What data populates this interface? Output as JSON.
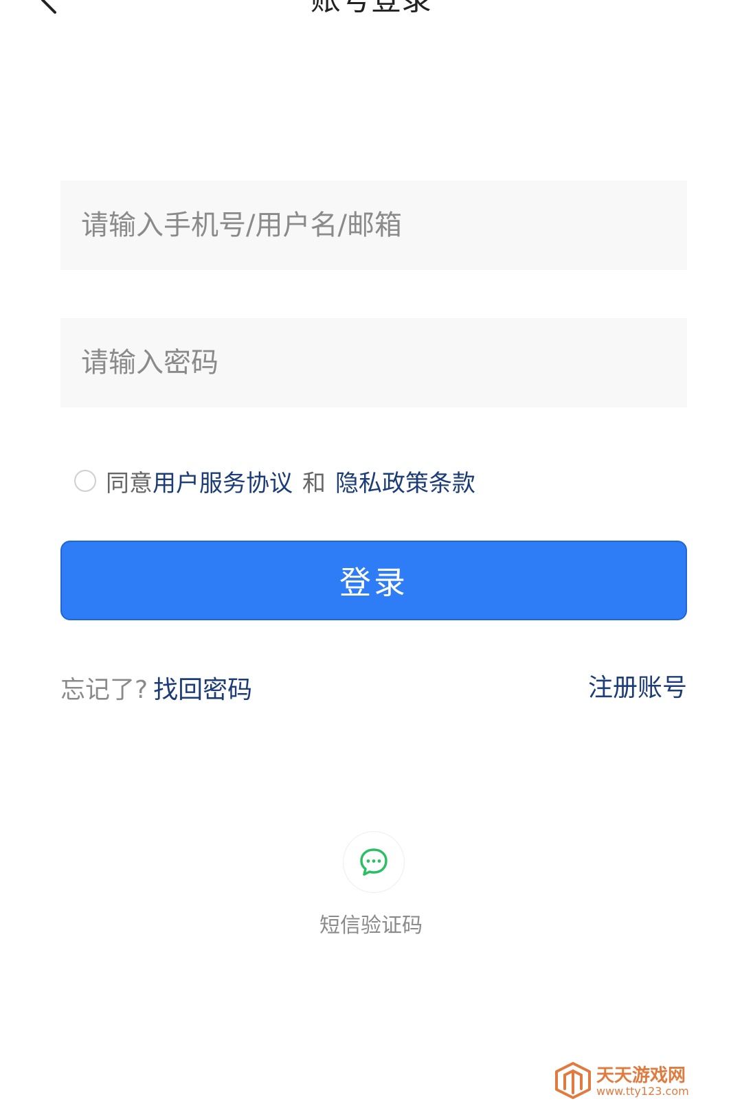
{
  "header": {
    "title": "账号登录",
    "back_icon": "back-chevron-icon"
  },
  "form": {
    "account_placeholder": "请输入手机号/用户名/邮箱",
    "password_placeholder": "请输入密码"
  },
  "agreement": {
    "prefix": "同意",
    "user_agreement": "用户服务协议",
    "and": "和",
    "privacy_policy": "隐私政策条款",
    "checked": false
  },
  "login_button": "登录",
  "links": {
    "forgot_prefix": "忘记了?",
    "recover_password": "找回密码",
    "register": "注册账号"
  },
  "alt_login": {
    "icon": "chat-bubble-icon",
    "label": "短信验证码"
  },
  "watermark": {
    "name": "天天游戏网",
    "url": "www.tty123.com"
  },
  "colors": {
    "primary": "#2e7cf6",
    "link": "#1b3c78",
    "sms_icon": "#2bbf63",
    "watermark": "#e07a3e"
  }
}
